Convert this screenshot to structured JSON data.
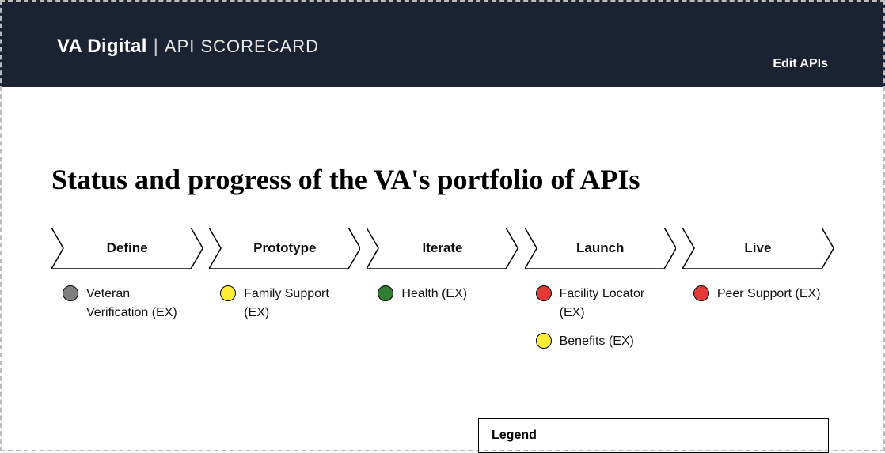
{
  "header": {
    "logo_bold": "VA Digital",
    "logo_thin": "API SCORECARD",
    "edit_link": "Edit APIs"
  },
  "title": "Status and progress of the VA's portfolio of APIs",
  "colors": {
    "gray": "#808080",
    "yellow": "#ffee33",
    "green": "#2e7d32",
    "red": "#e53935"
  },
  "stages": [
    {
      "name": "Define",
      "apis": [
        {
          "label": "Veteran Verification (EX)",
          "status": "gray"
        }
      ]
    },
    {
      "name": "Prototype",
      "apis": [
        {
          "label": "Family Support (EX)",
          "status": "yellow"
        }
      ]
    },
    {
      "name": "Iterate",
      "apis": [
        {
          "label": "Health (EX)",
          "status": "green"
        }
      ]
    },
    {
      "name": "Launch",
      "apis": [
        {
          "label": "Facility Locator (EX)",
          "status": "red"
        },
        {
          "label": "Benefits (EX)",
          "status": "yellow"
        }
      ]
    },
    {
      "name": "Live",
      "apis": [
        {
          "label": "Peer Support (EX)",
          "status": "red"
        }
      ]
    }
  ],
  "legend": {
    "title": "Legend"
  }
}
